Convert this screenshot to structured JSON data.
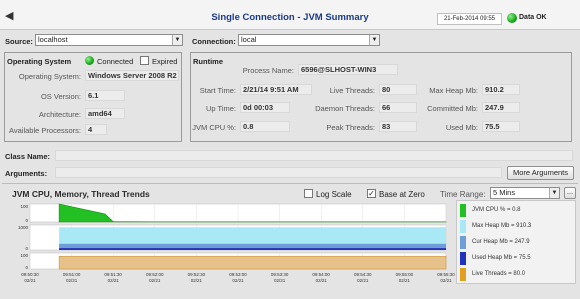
{
  "header": {
    "title": "Single Connection - JVM Summary",
    "date": "21-Feb-2014 09:55",
    "status": "Data OK",
    "status_color": "#17a517"
  },
  "source": {
    "label": "Source:",
    "value": "localhost"
  },
  "connection": {
    "label": "Connection:",
    "value": "local"
  },
  "os_panel": {
    "title": "Operating System",
    "connected_label": "Connected",
    "expired_label": "Expired",
    "fields": [
      {
        "label": "Operating System:",
        "value": "Windows Server 2008 R2"
      },
      {
        "label": "OS Version:",
        "value": "6.1"
      },
      {
        "label": "Architecture:",
        "value": "amd64"
      },
      {
        "label": "Available Processors:",
        "value": "4"
      }
    ]
  },
  "runtime": {
    "title": "Runtime",
    "process_name_label": "Process Name:",
    "process_name": "6596@SLHOST-WIN3",
    "start_time_label": "Start Time:",
    "start_time": "2/21/14 9:51 AM",
    "up_time_label": "Up Time:",
    "up_time": "0d 00:03",
    "cpu_label": "JVM CPU %:",
    "cpu": "0.8",
    "live_threads_label": "Live Threads:",
    "live_threads": "80",
    "daemon_threads_label": "Daemon Threads:",
    "daemon_threads": "66",
    "peak_threads_label": "Peak Threads:",
    "peak_threads": "83",
    "max_heap_label": "Max Heap Mb:",
    "max_heap": "910.2",
    "committed_label": "Committed Mb:",
    "committed": "247.9",
    "used_label": "Used Mb:",
    "used": "75.5"
  },
  "class_name_label": "Class Name:",
  "arguments_label": "Arguments:",
  "more_arguments": "More Arguments",
  "trends": {
    "title": "JVM CPU, Memory, Thread Trends",
    "log_scale": "Log Scale",
    "base_at_zero": "Base at Zero",
    "time_range_label": "Time Range:",
    "time_range": "5 Mins",
    "more_btn": "...",
    "legend": [
      {
        "label": "JVM CPU % = 0.8",
        "color": "#22c022"
      },
      {
        "label": "Max Heap Mb = 910.3",
        "color": "#a9e8f5"
      },
      {
        "label": "Cur Heap Mb = 247.9",
        "color": "#6e9ed8"
      },
      {
        "label": "Used Heap Mb = 75.5",
        "color": "#2233bb"
      },
      {
        "label": "Live Threads = 80.0",
        "color": "#e0a020"
      }
    ]
  },
  "chart_data": {
    "type": "area",
    "x_ticks": [
      {
        "time": "09:50:30",
        "date": "02/21"
      },
      {
        "time": "09:51:00",
        "date": "02/21"
      },
      {
        "time": "09:51:30",
        "date": "02/21"
      },
      {
        "time": "09:52:00",
        "date": "02/21"
      },
      {
        "time": "09:52:30",
        "date": "02/21"
      },
      {
        "time": "09:53:00",
        "date": "02/21"
      },
      {
        "time": "09:53:30",
        "date": "02/21"
      },
      {
        "time": "09:54:00",
        "date": "02/21"
      },
      {
        "time": "09:54:30",
        "date": "02/21"
      },
      {
        "time": "09:55:00",
        "date": "02/21"
      },
      {
        "time": "09:55:30",
        "date": "02/21"
      }
    ],
    "y_ticks": {
      "cpu": [
        "100",
        "0"
      ],
      "memory": [
        "1000",
        "0"
      ],
      "threads": [
        "100",
        "0"
      ]
    },
    "series": [
      {
        "name": "JVM CPU %",
        "x": [
          0.7,
          1.8,
          2,
          3,
          4,
          5,
          6,
          7,
          8,
          9,
          10
        ],
        "y": [
          100,
          45,
          2,
          1,
          1,
          1,
          1,
          1,
          1,
          1,
          1
        ]
      },
      {
        "name": "Max Heap Mb",
        "value": 910.3
      },
      {
        "name": "Cur Heap Mb",
        "value": 247.9
      },
      {
        "name": "Used Heap Mb",
        "value": 75.5
      },
      {
        "name": "Live Threads",
        "value": 80.0
      }
    ]
  }
}
